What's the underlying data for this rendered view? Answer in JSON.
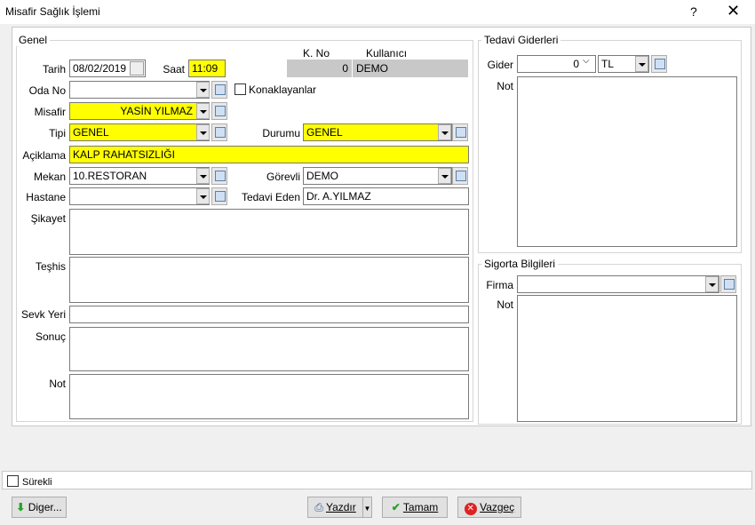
{
  "window": {
    "title": "Misafir Sağlık İşlemi",
    "help": "?",
    "close": "✕"
  },
  "genel": {
    "legend": "Genel",
    "kno_label": "K. No",
    "kullanici_label": "Kullanıcı",
    "kno_value": "0",
    "kullanici_value": "DEMO",
    "tarih_label": "Tarih",
    "tarih_value": "08/02/2019",
    "saat_label": "Saat",
    "saat_value": "11:09",
    "odano_label": "Oda No",
    "odano_value": "",
    "konaklayanlar_label": "Konaklayanlar",
    "misafir_label": "Misafir",
    "misafir_value": "YASİN YILMAZ",
    "tipi_label": "Tipi",
    "tipi_value": "GENEL",
    "durumu_label": "Durumu",
    "durumu_value": "GENEL",
    "aciklama_label": "Açiklama",
    "aciklama_value": "KALP RAHATSIZLIĞI",
    "mekan_label": "Mekan",
    "mekan_value": "10.RESTORAN",
    "gorevli_label": "Görevli",
    "gorevli_value": "DEMO",
    "hastane_label": "Hastane",
    "hastane_value": "",
    "tedavieden_label": "Tedavi Eden",
    "tedavieden_value": "Dr. A.YILMAZ",
    "sikayet_label": "Şikayet",
    "teshis_label": "Teşhis",
    "sevkyeri_label": "Sevk Yeri",
    "sonuc_label": "Sonuç",
    "not_label": "Not"
  },
  "tedavi": {
    "legend": "Tedavi Giderleri",
    "gider_label": "Gider",
    "gider_value": "0",
    "currency_value": "TL",
    "not_label": "Not"
  },
  "sigorta": {
    "legend": "Sigorta Bilgileri",
    "firma_label": "Firma",
    "firma_value": "",
    "not_label": "Not"
  },
  "footer": {
    "surekli_label": "Sürekli",
    "diger_label": "Diger...",
    "yazdir_label": "Yazdır",
    "tamam_label": "Tamam",
    "vazgec_label": "Vazgeç"
  },
  "colors": {
    "highlight": "#ffff00",
    "readonly": "#c8c8c8"
  }
}
